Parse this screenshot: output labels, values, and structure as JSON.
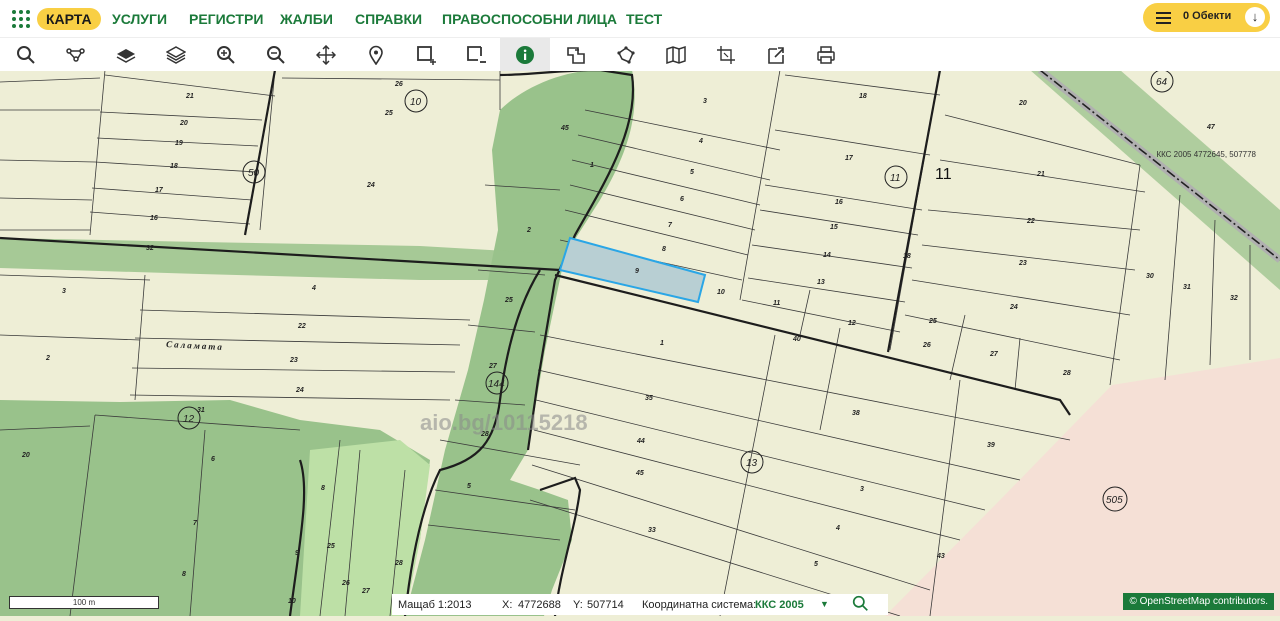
{
  "nav": {
    "items": [
      "КАРТА",
      "УСЛУГИ",
      "РЕГИСТРИ",
      "ЖАЛБИ",
      "СПРАВКИ",
      "ПРАВОСПОСОБНИ ЛИЦА",
      "ТЕСТ"
    ],
    "objects_label": "0 Обекти",
    "objects_icon": "menu-icon",
    "download_icon": "arrow-down-icon"
  },
  "toolbar": {
    "tools": [
      "search-icon",
      "node-route-icon",
      "layers-icon",
      "layer-stack-icon",
      "zoom-in-icon",
      "zoom-out-icon",
      "pan-move-icon",
      "location-pin-icon",
      "rectangle-select-icon",
      "rectangle-deselect-icon",
      "info-icon",
      "map-document-icon",
      "polygon-icon",
      "map-fold-icon",
      "crop-icon",
      "export-icon",
      "print-icon"
    ],
    "active_tool": "info-icon"
  },
  "map": {
    "coordinate_readout": "ККС 2005 4772645, 507778",
    "watermark": "aio.bg/10115218",
    "region_label": "Саламата",
    "large_number": "11",
    "circled_labels": [
      "10",
      "50",
      "64",
      "11",
      "144",
      "12",
      "13",
      "505"
    ],
    "parcel_labels": [
      "26",
      "21",
      "20",
      "19",
      "18",
      "17",
      "16",
      "32",
      "24",
      "25",
      "3",
      "2",
      "22",
      "23",
      "24",
      "45",
      "1",
      "2",
      "25",
      "27",
      "28",
      "5",
      "3",
      "4",
      "5",
      "6",
      "7",
      "8",
      "9",
      "10",
      "11",
      "12",
      "13",
      "14",
      "15",
      "16",
      "17",
      "18",
      "20",
      "47",
      "21",
      "22",
      "23",
      "24",
      "25",
      "26",
      "27",
      "28",
      "30",
      "31",
      "32",
      "1",
      "35",
      "44",
      "45",
      "33",
      "40",
      "38",
      "39",
      "3",
      "4",
      "5",
      "43",
      "31",
      "6",
      "7",
      "8",
      "9",
      "8",
      "25",
      "26",
      "27",
      "28",
      "20",
      "10"
    ],
    "colors": {
      "parcel_fill": "#eeeed6",
      "forest_fill": "#99c28b",
      "light_forest_fill": "#bde0a6",
      "pink_zone": "#f5e0d6",
      "selected_parcel_stroke": "#2aa6e6",
      "selected_parcel_fill": "#b8cfd3"
    }
  },
  "scale": {
    "label": "100 m"
  },
  "status": {
    "scale_label": "Мащаб 1:",
    "scale_value": "2013",
    "x_label": "X:",
    "x_value": "4772688",
    "y_label": "Y:",
    "y_value": "507714",
    "crs_label": "Координатна система:",
    "crs_value": "ККС 2005",
    "crs_caret": "▼",
    "search_icon": "search-icon"
  },
  "attribution": "© OpenStreetMap contributors."
}
